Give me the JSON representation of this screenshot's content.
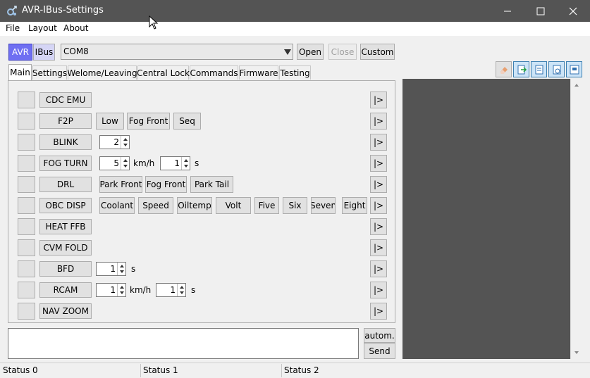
{
  "window": {
    "title": "AVR-IBus-Settings"
  },
  "menu": [
    "File",
    "Layout",
    "About"
  ],
  "toolbar": {
    "avr_label": "AVR",
    "ibus_label": "IBus",
    "port_value": "COM8",
    "open_label": "Open",
    "close_label": "Close",
    "custom_label": "Custom"
  },
  "tabs": [
    "Main",
    "Settings",
    "Welome/Leaving",
    "Central Lock",
    "Commands",
    "Firmware",
    "Testing"
  ],
  "rows": {
    "cdc": {
      "label": "CDC EMU"
    },
    "f2p": {
      "label": "F2P",
      "options": [
        "Low",
        "Fog Front",
        "Seq"
      ]
    },
    "blink": {
      "label": "BLINK",
      "value": "2"
    },
    "fogturn": {
      "label": "FOG TURN",
      "speed": "5",
      "speed_unit": "km/h",
      "time": "1",
      "time_unit": "s"
    },
    "drl": {
      "label": "DRL",
      "options": [
        "Park Front",
        "Fog Front",
        "Park Tail"
      ]
    },
    "obc": {
      "label": "OBC DISP",
      "options": [
        "Coolant",
        "Speed",
        "Oiltemp",
        "Volt",
        "Five",
        "Six",
        "Seven",
        "Eight"
      ]
    },
    "heat": {
      "label": "HEAT FFB"
    },
    "cvm": {
      "label": "CVM FOLD"
    },
    "bfd": {
      "label": "BFD",
      "value": "1",
      "unit": "s"
    },
    "rcam": {
      "label": "RCAM",
      "speed": "1",
      "speed_unit": "km/h",
      "time": "1",
      "time_unit": "s"
    },
    "navzoom": {
      "label": "NAV ZOOM"
    },
    "play_label": "|>"
  },
  "command": {
    "autom_label": "autom.",
    "send_label": "Send"
  },
  "status": [
    "Status 0",
    "Status 1",
    "Status 2"
  ],
  "colors": {
    "titlebar": "#545454",
    "active_toggle": "#6f6ff2",
    "log_panel": "#545454"
  }
}
